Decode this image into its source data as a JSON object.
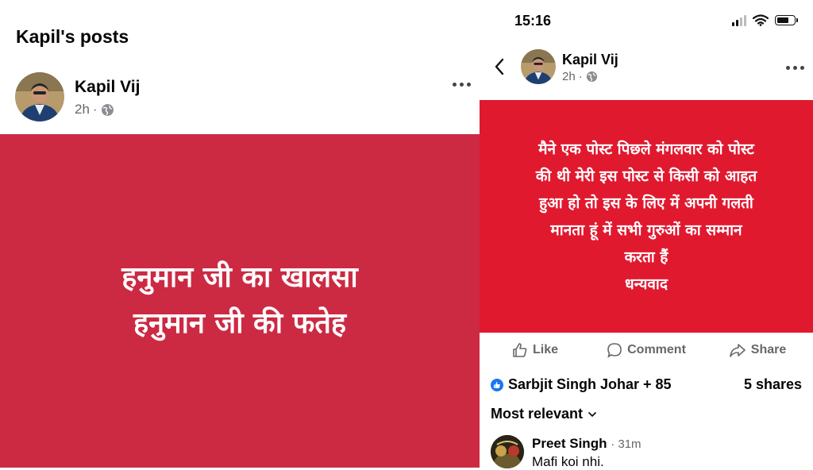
{
  "left_panel": {
    "page_title": "Kapil's posts",
    "author": {
      "name": "Kapil Vij",
      "time": "2h",
      "separator": "·",
      "privacy_icon": "globe-icon"
    },
    "more_icon": "more-horizontal-icon",
    "post_lines": [
      "हनुमान जी का खालसा",
      "हनुमान जी की फतेह"
    ],
    "post_bg": "#cc2a43"
  },
  "right_panel": {
    "status_bar": {
      "time": "15:16",
      "icons": [
        "signal-icon",
        "wifi-icon",
        "battery-icon"
      ]
    },
    "back_icon": "chevron-left-icon",
    "author": {
      "name": "Kapil Vij",
      "time": "2h",
      "separator": "·",
      "privacy_icon": "globe-icon"
    },
    "more_icon": "more-horizontal-icon",
    "post_lines": [
      "मैने एक पोस्ट पिछले मंगलवार को पोस्ट",
      "की थी  मेरी इस पोस्ट से किसी को आहत",
      "हुआ हो तो इस के लिए में अपनी गलती",
      "मानता हूं में सभी गुरुओं का सम्मान",
      "करता हैं",
      "धन्यवाद"
    ],
    "post_bg": "#e0192f",
    "actions": {
      "like": "Like",
      "comment": "Comment",
      "share": "Share"
    },
    "reactions": {
      "text": "Sarbjit Singh Johar + 85",
      "icon": "like-reaction-icon",
      "accent": "#1877f2"
    },
    "shares": "5 shares",
    "sort": "Most relevant",
    "comment": {
      "name": "Preet Singh",
      "time": "· 31m",
      "text": "Mafi koi nhi."
    }
  }
}
